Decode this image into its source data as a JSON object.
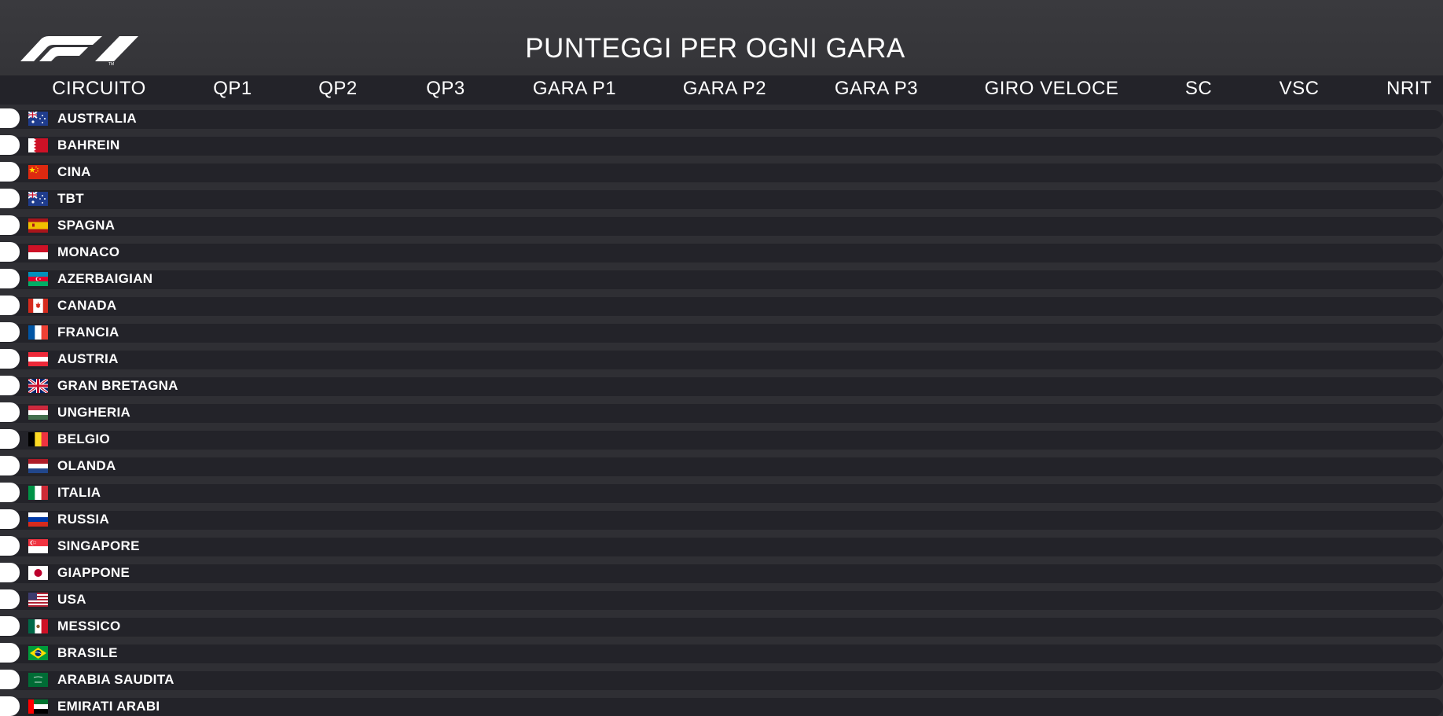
{
  "header": {
    "title": "PUNTEGGI PER OGNI GARA",
    "logo": "f1-logo"
  },
  "columns": [
    "CIRCUITO",
    "QP1",
    "QP2",
    "QP3",
    "GARA P1",
    "GARA P2",
    "GARA P3",
    "GIRO VELOCE",
    "SC",
    "VSC",
    "NRIT"
  ],
  "rows": [
    {
      "name": "AUSTRALIA",
      "flag": "au"
    },
    {
      "name": "BAHREIN",
      "flag": "bh"
    },
    {
      "name": "CINA",
      "flag": "cn"
    },
    {
      "name": "TBT",
      "flag": "au"
    },
    {
      "name": "SPAGNA",
      "flag": "es"
    },
    {
      "name": "MONACO",
      "flag": "mc"
    },
    {
      "name": "AZERBAIGIAN",
      "flag": "az"
    },
    {
      "name": "CANADA",
      "flag": "ca"
    },
    {
      "name": "FRANCIA",
      "flag": "fr"
    },
    {
      "name": "AUSTRIA",
      "flag": "at"
    },
    {
      "name": "GRAN BRETAGNA",
      "flag": "gb"
    },
    {
      "name": "UNGHERIA",
      "flag": "hu"
    },
    {
      "name": "BELGIO",
      "flag": "be"
    },
    {
      "name": "OLANDA",
      "flag": "nl"
    },
    {
      "name": "ITALIA",
      "flag": "it"
    },
    {
      "name": "RUSSIA",
      "flag": "ru"
    },
    {
      "name": "SINGAPORE",
      "flag": "sg"
    },
    {
      "name": "GIAPPONE",
      "flag": "jp"
    },
    {
      "name": "USA",
      "flag": "us"
    },
    {
      "name": "MESSICO",
      "flag": "mx"
    },
    {
      "name": "BRASILE",
      "flag": "br"
    },
    {
      "name": "ARABIA SAUDITA",
      "flag": "sa"
    },
    {
      "name": "EMIRATI ARABI",
      "flag": "ae"
    }
  ],
  "colors": {
    "background": "#2f2f34",
    "row_bar": "#232329",
    "text": "#ffffff"
  }
}
